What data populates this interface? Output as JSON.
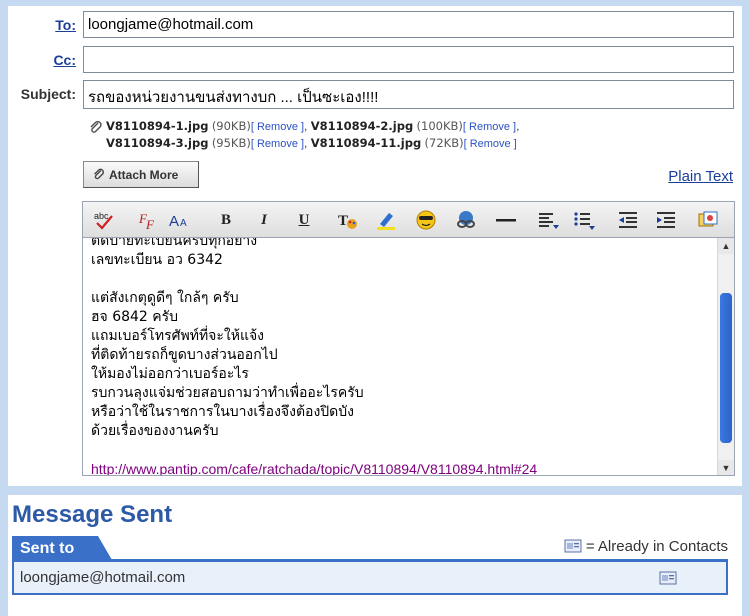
{
  "compose": {
    "to": {
      "label": "To:",
      "value": "loongjame@hotmail.com"
    },
    "cc": {
      "label": "Cc:",
      "value": ""
    },
    "subject": {
      "label": "Subject:",
      "value": "รถของหน่วยงานขนส่งทางบก ... เป็นซะเอง!!!!"
    },
    "attachments": [
      {
        "name": "V8110894-1.jpg",
        "size": "(90KB)",
        "remove": "[ Remove ]",
        "sep": ","
      },
      {
        "name": "V8110894-2.jpg",
        "size": "(100KB)",
        "remove": "[ Remove ]",
        "sep": ","
      },
      {
        "name": "V8110894-3.jpg",
        "size": "(95KB)",
        "remove": "[ Remove ]",
        "sep": ","
      },
      {
        "name": "V8110894-11.jpg",
        "size": "(72KB)",
        "remove": "[ Remove ]",
        "sep": ""
      }
    ],
    "attach_more_label": "Attach More",
    "plain_text_label": "Plain Text",
    "toolbar": [
      "spellcheck-icon",
      "font-icon",
      "font-size-icon",
      "bold-icon",
      "italic-icon",
      "underline-icon",
      "text-color-icon",
      "highlight-icon",
      "emoticon-icon",
      "link-icon",
      "horizontal-rule-icon",
      "align-icon",
      "bullet-list-icon",
      "outdent-icon",
      "indent-icon",
      "stationery-icon"
    ],
    "body_lines": [
      "ติดป้ายทะเบียนครบทุกอย่าง",
      "เลขทะเบียน อว 6342",
      "",
      "แต่สังเกตุดูดีๆ ใกล้ๆ ครับ",
      "ฮจ 6842 ครับ",
      "แถมเบอร์โทรศัพท์ที่จะให้แจ้ง",
      "ที่ติดท้ายรถก็ขูดบางส่วนออกไป",
      "ให้มองไม่ออกว่าเบอร์อะไร",
      "รบกวนลุงแจ่มช่วยสอบถามว่าทำเพื่ออะไรครับ",
      "หรือว่าใช้ในราชการในบางเรื่องจึงต้องปิดบัง",
      "ด้วยเรื่องของงานครับ",
      ""
    ],
    "body_link": "http://www.pantip.com/cafe/ratchada/topic/V8110894/V8110894.html#24"
  },
  "sent": {
    "title": "Message Sent",
    "tab_label": "Sent to",
    "legend_text": "= Already in Contacts",
    "recipient": "loongjame@hotmail.com"
  }
}
